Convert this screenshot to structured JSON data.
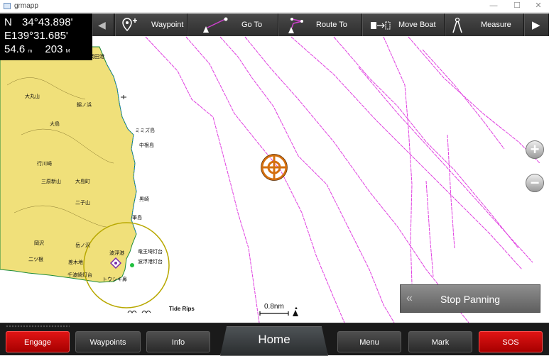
{
  "window": {
    "title": "grmapp",
    "minimize": "—",
    "maximize": "☐",
    "close": "✕"
  },
  "position": {
    "lat_hemi": "N",
    "lat": "34°43.898'",
    "lon_hemi": "E",
    "lon": "139°31.685'",
    "depth": "54.6",
    "depth_unit": "m",
    "heading": "203",
    "heading_unit": "M"
  },
  "toolbar": {
    "left_arrow": "◀",
    "right_arrow": "▶",
    "waypoint": "Waypoint",
    "goto": "Go To",
    "route_to": "Route To",
    "move_boat": "Move Boat",
    "measure": "Measure"
  },
  "map": {
    "labels": [
      {
        "text": "岡田港",
        "name": "label-okada"
      },
      {
        "text": "大丸山",
        "name": "label-omaruyama"
      },
      {
        "text": "錦ノ浜",
        "name": "label-nishikinohama"
      },
      {
        "text": "大島",
        "name": "label-oshima"
      },
      {
        "text": "ミミズ島",
        "name": "label-mimizu"
      },
      {
        "text": "中根島",
        "name": "label-nakane"
      },
      {
        "text": "行川崎",
        "name": "label-namekawa"
      },
      {
        "text": "三原新山",
        "name": "label-mihara"
      },
      {
        "text": "大島町",
        "name": "label-oshima-machi"
      },
      {
        "text": "黒崎",
        "name": "label-kurosaki"
      },
      {
        "text": "二子山",
        "name": "label-futagoyama"
      },
      {
        "text": "筆島",
        "name": "label-fudeshima"
      },
      {
        "text": "岡沢",
        "name": "label-okazawa"
      },
      {
        "text": "岳ノ沢",
        "name": "label-takenosawa"
      },
      {
        "text": "波浮港",
        "name": "label-habuminato"
      },
      {
        "text": "竜王埼灯台",
        "name": "label-ryuozaki"
      },
      {
        "text": "二ツ根",
        "name": "label-futatsune"
      },
      {
        "text": "波浮港灯台",
        "name": "label-habu-lighthouse"
      },
      {
        "text": "差木地",
        "name": "label-sashikiji"
      },
      {
        "text": "千波崎灯台",
        "name": "label-senbasaki"
      },
      {
        "text": "トウシキ鼻",
        "name": "label-toushiki"
      }
    ],
    "tide_rips": "Tide Rips",
    "scale": "0.8nm",
    "zoom_in": "+",
    "zoom_out": "−",
    "stop_panning": "Stop Panning",
    "stop_chevron": "«"
  },
  "bottom": {
    "engage": "Engage",
    "waypoints": "Waypoints",
    "info": "Info",
    "home": "Home",
    "menu": "Menu",
    "mark": "Mark",
    "sos": "SOS"
  },
  "colors": {
    "land": "#f0e07a",
    "route": "#e040e0",
    "pan_cursor": "#d4700f",
    "sos_red": "#d00000"
  }
}
